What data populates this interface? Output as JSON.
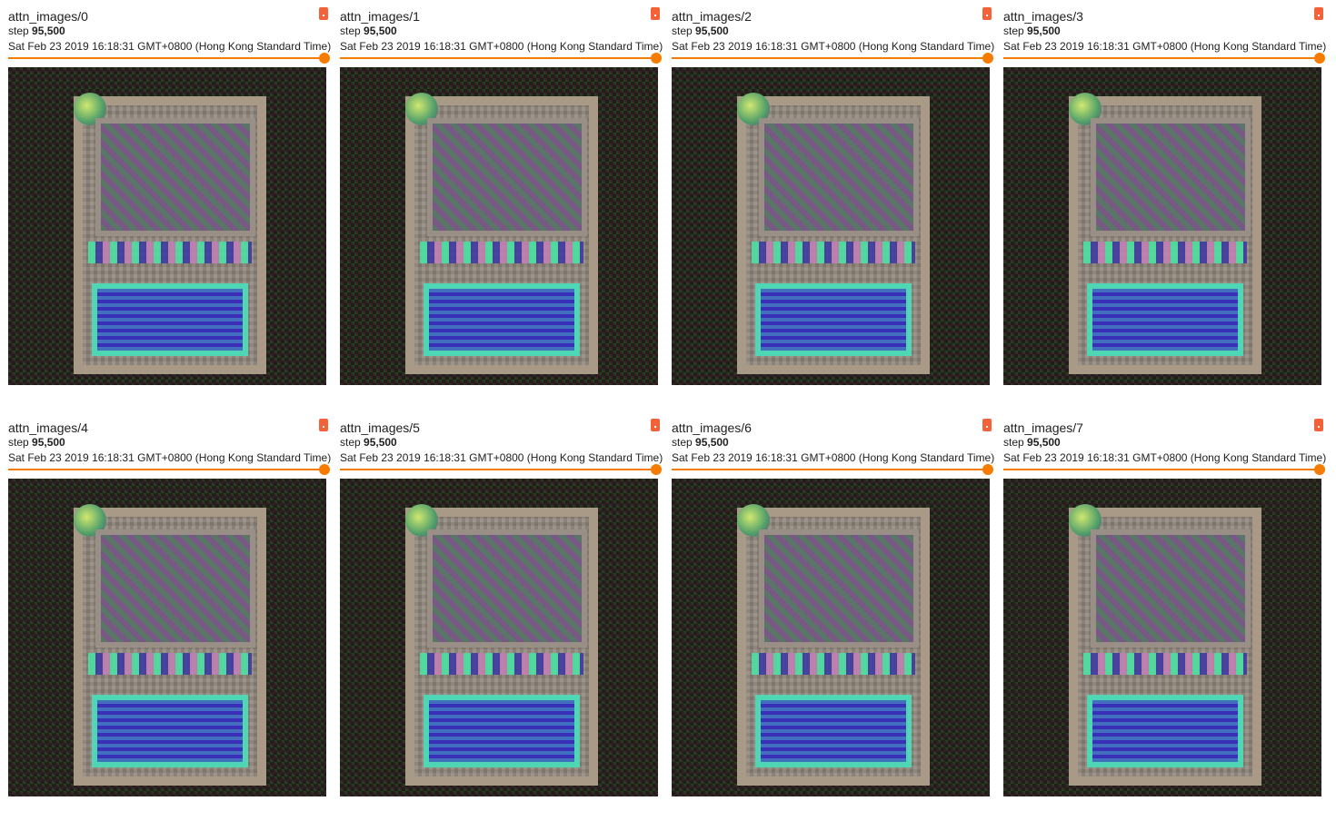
{
  "cards": [
    {
      "title": "attn_images/0",
      "step_label": "step",
      "step_value": "95,500",
      "timestamp": "Sat Feb 23 2019 16:18:31 GMT+0800 (Hong Kong Standard Time)",
      "slider_fraction": 1.0
    },
    {
      "title": "attn_images/1",
      "step_label": "step",
      "step_value": "95,500",
      "timestamp": "Sat Feb 23 2019 16:18:31 GMT+0800 (Hong Kong Standard Time)",
      "slider_fraction": 1.0
    },
    {
      "title": "attn_images/2",
      "step_label": "step",
      "step_value": "95,500",
      "timestamp": "Sat Feb 23 2019 16:18:31 GMT+0800 (Hong Kong Standard Time)",
      "slider_fraction": 1.0
    },
    {
      "title": "attn_images/3",
      "step_label": "step",
      "step_value": "95,500",
      "timestamp": "Sat Feb 23 2019 16:18:31 GMT+0800 (Hong Kong Standard Time)",
      "slider_fraction": 1.0
    },
    {
      "title": "attn_images/4",
      "step_label": "step",
      "step_value": "95,500",
      "timestamp": "Sat Feb 23 2019 16:18:31 GMT+0800 (Hong Kong Standard Time)",
      "slider_fraction": 1.0
    },
    {
      "title": "attn_images/5",
      "step_label": "step",
      "step_value": "95,500",
      "timestamp": "Sat Feb 23 2019 16:18:31 GMT+0800 (Hong Kong Standard Time)",
      "slider_fraction": 1.0
    },
    {
      "title": "attn_images/6",
      "step_label": "step",
      "step_value": "95,500",
      "timestamp": "Sat Feb 23 2019 16:18:31 GMT+0800 (Hong Kong Standard Time)",
      "slider_fraction": 1.0
    },
    {
      "title": "attn_images/7",
      "step_label": "step",
      "step_value": "95,500",
      "timestamp": "Sat Feb 23 2019 16:18:31 GMT+0800 (Hong Kong Standard Time)",
      "slider_fraction": 1.0
    }
  ],
  "colors": {
    "slider": "#f57c00",
    "expand_button": "#f4623a"
  },
  "icons": {
    "expand": "expand-icon"
  }
}
